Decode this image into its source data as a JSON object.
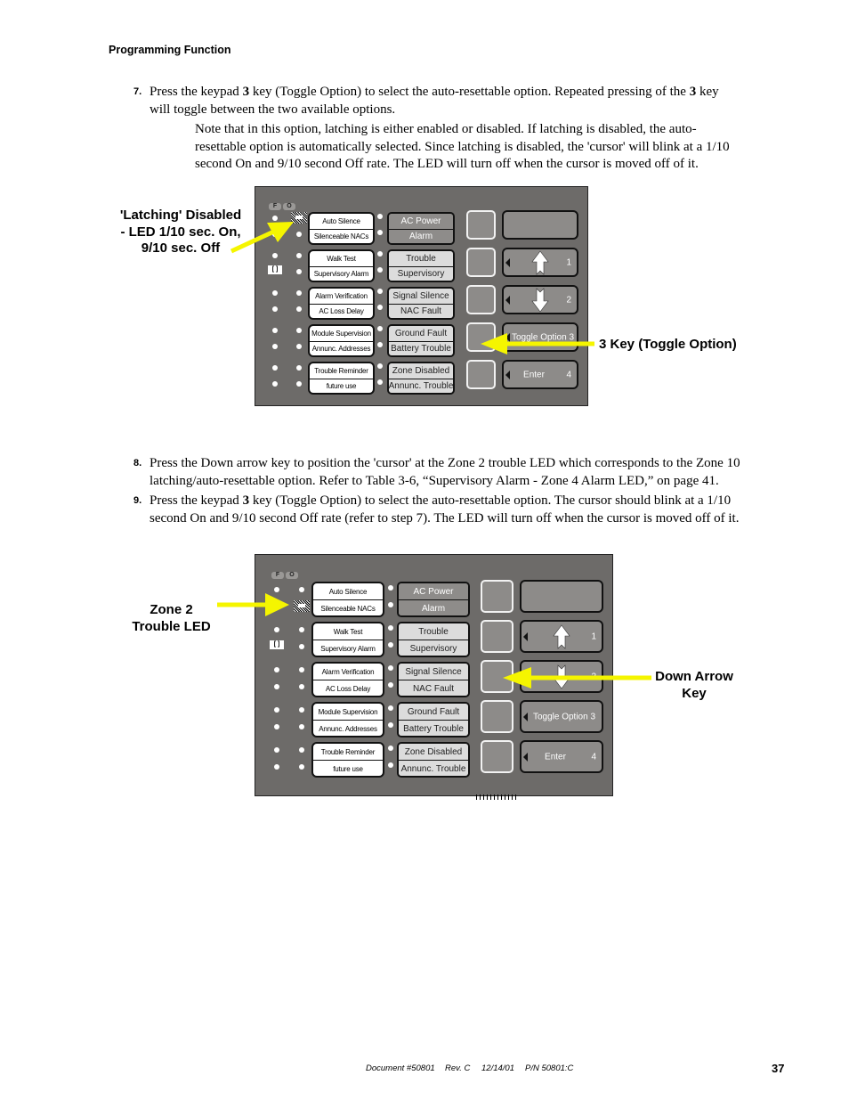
{
  "header": {
    "section": "Programming Function"
  },
  "steps": [
    {
      "number": "7.",
      "lines": [
        "Press the keypad ",
        "3",
        " key (Toggle Option) to select the auto-resettable option.  Repeated pressing of the ",
        "3",
        " key",
        "will toggle between the two available options."
      ],
      "note": [
        "Note that in this option, latching is either enabled or disabled.  If latching is disabled, the auto-",
        "resettable option is automatically selected.  Since latching is disabled, the 'cursor' will blink at a 1/10",
        "second On and 9/10 second Off rate.  The LED will turn off when the cursor is moved off of it."
      ]
    },
    {
      "number": "8.",
      "lines": [
        "Press the Down arrow key to position the 'cursor' at the Zone 2 trouble LED which corresponds to the Zone 10",
        "latching/auto-resettable option.  Refer to Table 3-6, “Supervisory Alarm - Zone 4 Alarm LED,” on page 41."
      ]
    },
    {
      "number": "9.",
      "lines": [
        "Press the keypad ",
        "3",
        " key (Toggle Option) to select the auto-resettable option.  The cursor should blink at a 1/10",
        "second On and 9/10 second Off rate (refer to step 7).  The LED will turn off when the cursor is moved off of it."
      ]
    }
  ],
  "figure1": {
    "callout_left": [
      "'Latching' Disabled",
      "- LED 1/10 sec. On,",
      "9/10 sec. Off"
    ],
    "callout_right": "3 Key (Toggle Option)"
  },
  "figure2": {
    "callout_left": [
      "Zone 2",
      "Trouble LED"
    ],
    "callout_right": [
      "Down Arrow",
      "Key"
    ]
  },
  "panel": {
    "fo_labels": [
      "F",
      "O"
    ],
    "bracket_label": "[ ]",
    "label_groups": [
      [
        "Auto Silence",
        "Silenceable NACs"
      ],
      [
        "Walk Test",
        "Supervisory Alarm"
      ],
      [
        "Alarm Verification",
        "AC Loss Delay"
      ],
      [
        "Module Supervision",
        "Annunc. Addresses"
      ],
      [
        "Trouble Reminder",
        "future use"
      ]
    ],
    "status_groups": [
      [
        "AC Power",
        "Alarm"
      ],
      [
        "Trouble",
        "Supervisory"
      ],
      [
        "Signal Silence",
        "NAC Fault"
      ],
      [
        "Ground Fault",
        "Battery Trouble"
      ],
      [
        "Zone Disabled",
        "Annunc. Trouble"
      ]
    ],
    "keys": [
      {
        "label": "",
        "number": ""
      },
      {
        "label": "up-arrow",
        "number": "1"
      },
      {
        "label": "down-arrow",
        "number": "2"
      },
      {
        "label": "Toggle Option 3",
        "number": ""
      },
      {
        "label": "Enter",
        "number": "4"
      }
    ]
  },
  "footer": {
    "document": "Document #50801",
    "rev": "Rev. C",
    "date": "12/14/01",
    "pn": "P/N 50801:C",
    "page": "37"
  },
  "colors": {
    "panel": "#6d6b69",
    "callout_arrow": "#f5f500",
    "status_dark": "#8e8c8a",
    "status_light": "#dcdcdc"
  }
}
